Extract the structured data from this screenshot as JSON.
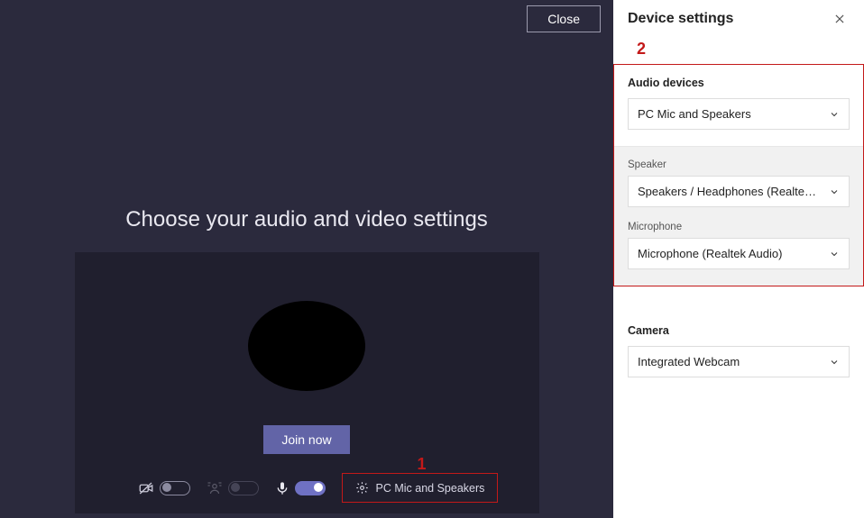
{
  "main": {
    "close_label": "Close",
    "heading": "Choose your audio and video settings",
    "join_label": "Join now",
    "device_label": "PC Mic and Speakers"
  },
  "annotations": {
    "one": "1",
    "two": "2"
  },
  "panel": {
    "title": "Device settings",
    "audio_section": {
      "label": "Audio devices",
      "combined": "PC Mic and Speakers",
      "speaker_label": "Speaker",
      "speaker_value": "Speakers / Headphones (Realtek Aud...",
      "mic_label": "Microphone",
      "mic_value": "Microphone (Realtek Audio)"
    },
    "camera_section": {
      "label": "Camera",
      "value": "Integrated Webcam"
    }
  }
}
